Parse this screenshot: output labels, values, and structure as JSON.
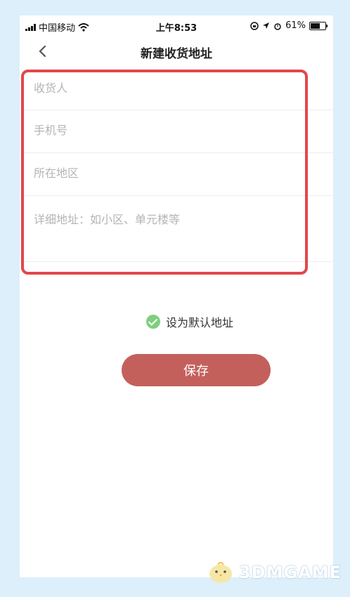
{
  "status_bar": {
    "carrier": "中国移动",
    "time": "上午8:53",
    "battery": "61%"
  },
  "nav": {
    "title": "新建收货地址"
  },
  "form": {
    "recipient_placeholder": "收货人",
    "phone_placeholder": "手机号",
    "region_placeholder": "所在地区",
    "address_placeholder": "详细地址：如小区、单元楼等"
  },
  "default_toggle": {
    "label": "设为默认地址",
    "checked": true
  },
  "save_button": {
    "label": "保存"
  },
  "watermark": {
    "logo_text": "3DMGAME"
  },
  "colors": {
    "save": "#c4605c",
    "highlight": "#e2474b",
    "check": "#7fcf7f",
    "background": "#dceffa"
  }
}
